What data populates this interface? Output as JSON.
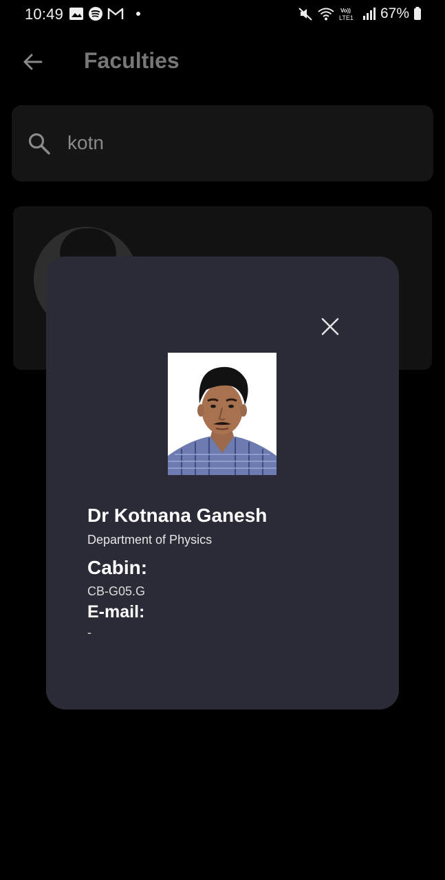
{
  "status_bar": {
    "time": "10:49",
    "battery": "67%",
    "network": "LTE1"
  },
  "header": {
    "title": "Faculties"
  },
  "search": {
    "value": "kotn"
  },
  "dialog": {
    "name": "Dr Kotnana Ganesh",
    "department": "Department of Physics",
    "cabin_label": "Cabin:",
    "cabin_value": "CB-G05.G",
    "email_label": "E-mail:",
    "email_value": "-"
  },
  "colors": {
    "background": "#000000",
    "dialog_bg": "#2b2b37",
    "search_bg": "#151515",
    "title_dim": "#777777"
  }
}
